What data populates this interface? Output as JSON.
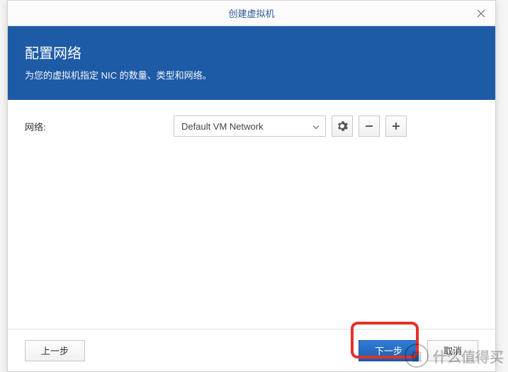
{
  "titlebar": {
    "title": "创建虚拟机"
  },
  "banner": {
    "heading": "配置网络",
    "subtext": "为您的虚拟机指定 NIC 的数量、类型和网络。"
  },
  "form": {
    "network_label": "网络:",
    "network_value": "Default VM Network"
  },
  "footer": {
    "back": "上一步",
    "next": "下一步",
    "cancel": "取消"
  },
  "watermark": {
    "badge": "值",
    "text": "什么值得买"
  }
}
